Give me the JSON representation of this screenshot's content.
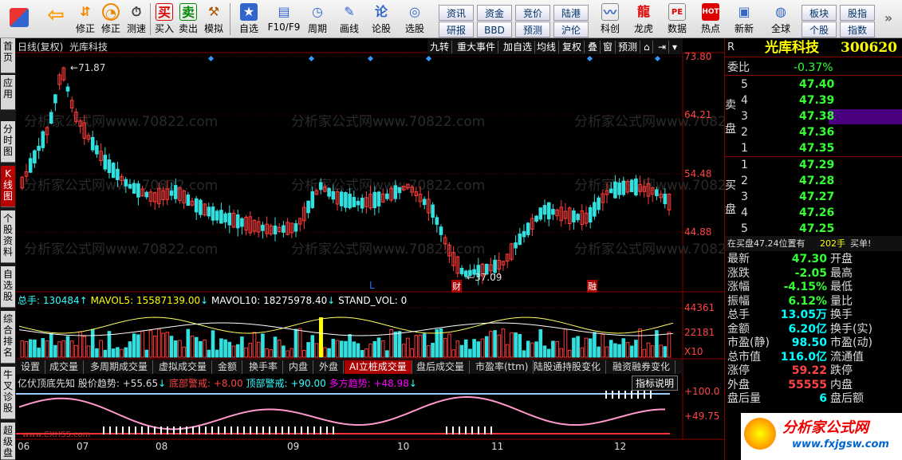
{
  "toolbar": {
    "btn_xiuzheng": "修正",
    "btn_cejue": "测速",
    "btn_mairu": "买入",
    "btn_maichu": "卖出",
    "btn_moni": "模拟",
    "btn_zixuan": "自选",
    "btn_f10": "F10/F9",
    "btn_zhouqi": "周期",
    "btn_huaxian": "画线",
    "btn_lungu": "论股",
    "btn_xuangu": "选股",
    "btn_kechuang": "科创",
    "btn_longhu": "龙虎",
    "btn_shuju": "数据",
    "btn_redian": "热点",
    "btn_xinxin": "新新",
    "btn_quanqiu": "全球",
    "small": [
      "资讯",
      "资金",
      "竞价",
      "陆港",
      "研报",
      "BBD",
      "预测",
      "沪伦"
    ],
    "right_small": [
      "板块",
      "股指",
      "个股",
      "指数"
    ],
    "mai": "买",
    "mai_c": "卖"
  },
  "lefttabs": [
    "首页",
    "应用",
    "分时图",
    "K线图",
    "个股资料",
    "自选股",
    "综合排名",
    "牛叉诊股",
    "超级盘"
  ],
  "chart": {
    "title": "日线(复权)",
    "stock": "光库科技",
    "controls": [
      "九转",
      "重大事件",
      "加自选",
      "均线",
      "复权",
      "叠",
      "窗",
      "预测"
    ],
    "price_axis": [
      "73.80",
      "64.21",
      "54.48",
      "44.88"
    ],
    "high_label": "71.87",
    "low_label": "37.09",
    "marker_L": "L",
    "marker_cai": "财",
    "marker_rongzi": "融",
    "watermark": "分析家公式网www.70822.com",
    "vol_label": "总手: 130484",
    "mavol5": "MAVOL5: 15587139.00",
    "mavol10": "MAVOL10: 18275978.40",
    "standvol": "STAND_VOL: 0",
    "vol_axis": [
      "44361",
      "22181",
      "X10"
    ],
    "ind_title": "亿伏顶底先知",
    "ind_trend": "股价趋势: +55.65",
    "ind_bottom": "底部警戒: +8.00",
    "ind_top": "顶部警戒: +90.00",
    "ind_multi": "多方趋势: +48.98",
    "ind_button": "指标说明",
    "ind_axis": [
      "+100.0",
      "+49.75"
    ],
    "ind_watermark": "www.CXHSS.com",
    "months": [
      "06",
      "07",
      "08",
      "09",
      "10",
      "11",
      "12"
    ]
  },
  "indtabs": [
    "设置",
    "成交量",
    "多周期成交量",
    "虚拟成交量",
    "金额",
    "换手率",
    "内盘",
    "外盘",
    "AI立桩成交量",
    "盘后成交量",
    "市盈率(ttm)",
    "陆股通持股变化",
    "融资融券变化"
  ],
  "quote": {
    "code_name": "光库科技",
    "code": "300620",
    "r_label": "R",
    "weibi_label": "委比",
    "weibi": "-0.37%",
    "sell_side": "卖盘",
    "buy_side": "买盘",
    "sell": [
      {
        "n": "5",
        "p": "47.40"
      },
      {
        "n": "4",
        "p": "47.39"
      },
      {
        "n": "3",
        "p": "47.38"
      },
      {
        "n": "2",
        "p": "47.36"
      },
      {
        "n": "1",
        "p": "47.35"
      }
    ],
    "buy": [
      {
        "n": "1",
        "p": "47.29"
      },
      {
        "n": "2",
        "p": "47.28"
      },
      {
        "n": "3",
        "p": "47.27"
      },
      {
        "n": "4",
        "p": "47.26"
      },
      {
        "n": "5",
        "p": "47.25"
      }
    ],
    "notice": "在买盘47.24位置有",
    "notice_qty": "202手",
    "notice_act": "买单!",
    "stats": [
      {
        "l1": "最新",
        "v1": "47.30",
        "l2": "开盘",
        "v2": ""
      },
      {
        "l1": "涨跌",
        "v1": "-2.05",
        "l2": "最高",
        "v2": ""
      },
      {
        "l1": "涨幅",
        "v1": "-4.15%",
        "l2": "最低",
        "v2": ""
      },
      {
        "l1": "振幅",
        "v1": "6.12%",
        "l2": "量比",
        "v2": ""
      },
      {
        "l1": "总手",
        "v1": "13.05万",
        "l2": "换手",
        "v2": ""
      },
      {
        "l1": "金额",
        "v1": "6.20亿",
        "l2": "换手(实)",
        "v2": ""
      },
      {
        "l1": "市盈(静)",
        "v1": "98.50",
        "l2": "市盈(动)",
        "v2": ""
      },
      {
        "l1": "总市值",
        "v1": "116.0亿",
        "l2": "流通值",
        "v2": ""
      },
      {
        "l1": "涨停",
        "v1": "59.22",
        "l2": "跌停",
        "v2": ""
      },
      {
        "l1": "外盘",
        "v1": "55555",
        "l2": "内盘",
        "v2": ""
      },
      {
        "l1": "盘后量",
        "v1": "6",
        "l2": "盘后额",
        "v2": ""
      }
    ],
    "brand": "分析家公式网",
    "brand_url": "www.fxjgsw.com"
  }
}
